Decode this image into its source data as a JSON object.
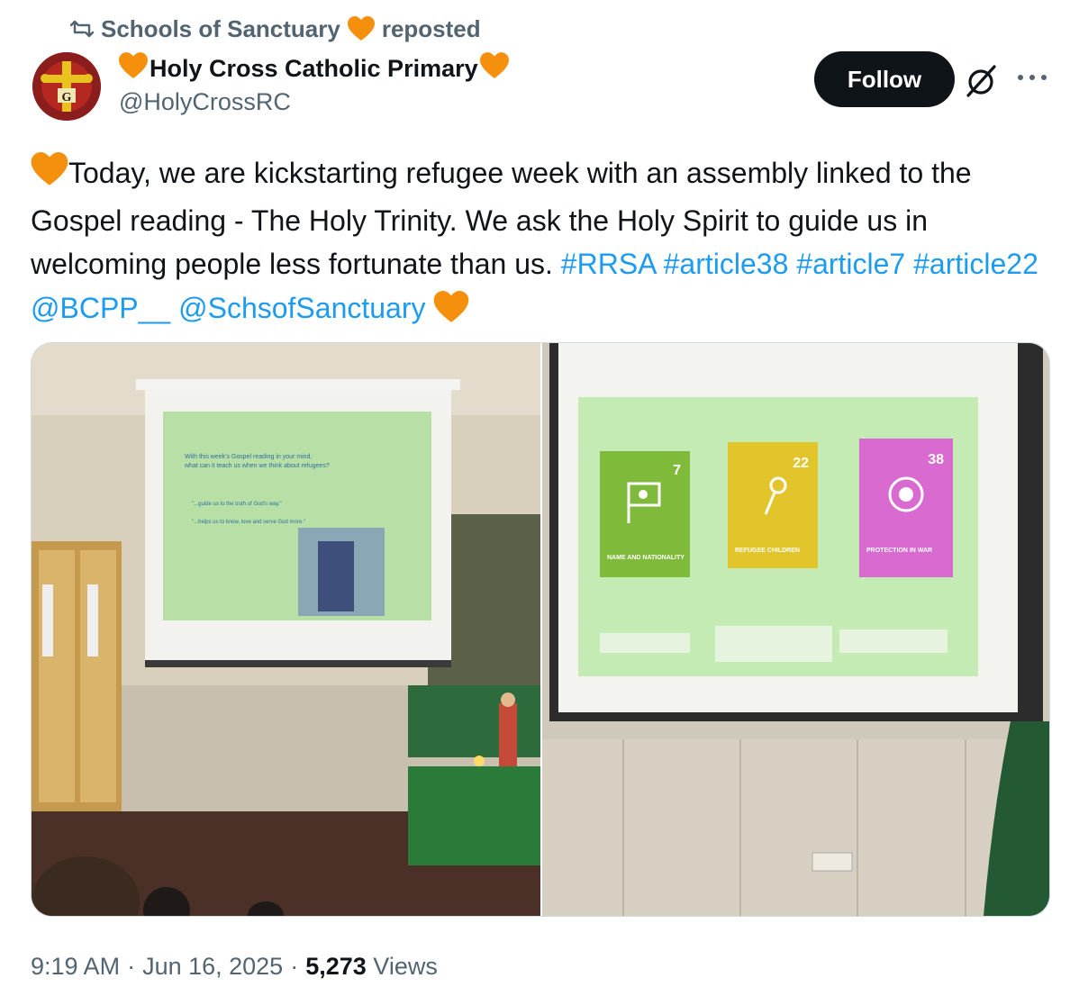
{
  "repost": {
    "account": "Schools of Sanctuary",
    "suffix": "reposted"
  },
  "author": {
    "name": "Holy Cross Catholic Primary",
    "handle": "@HolyCrossRC",
    "avatar_icon": "school-crest-icon"
  },
  "follow_label": "Follow",
  "tweet": {
    "text_main": "Today, we are kickstarting refugee week with an assembly linked to the Gospel reading - The Holy Trinity. We ask the Holy Spirit to guide us in welcoming people less fortunate than us. ",
    "links": [
      "#RRSA",
      "#article38",
      "#article7",
      "#article22",
      "@BCPP__",
      "@SchsofSanctuary"
    ]
  },
  "media": {
    "left_slide": {
      "line1": "With this week's Gospel reading in your mind,",
      "line2": "what can it teach us when we think about refugees?",
      "quote1": "\"...guide us to the truth of God's way.\"",
      "quote2": "\"...helps us to know, love and serve God more.\""
    },
    "right_slide": {
      "cards": [
        {
          "number": "7",
          "label": "NAME AND NATIONALITY",
          "color": "#7fba3a"
        },
        {
          "number": "22",
          "label": "REFUGEE CHILDREN",
          "color": "#e2c52a"
        },
        {
          "number": "38",
          "label": "PROTECTION IN WAR",
          "color": "#d86ad0"
        }
      ]
    }
  },
  "meta": {
    "time": "9:19 AM",
    "date": "Jun 16, 2025",
    "views_count": "5,273",
    "views_label": "Views"
  },
  "colors": {
    "link": "#1d9bf0",
    "heart": "#f4900c",
    "muted": "#536471",
    "text": "#0f1419"
  }
}
